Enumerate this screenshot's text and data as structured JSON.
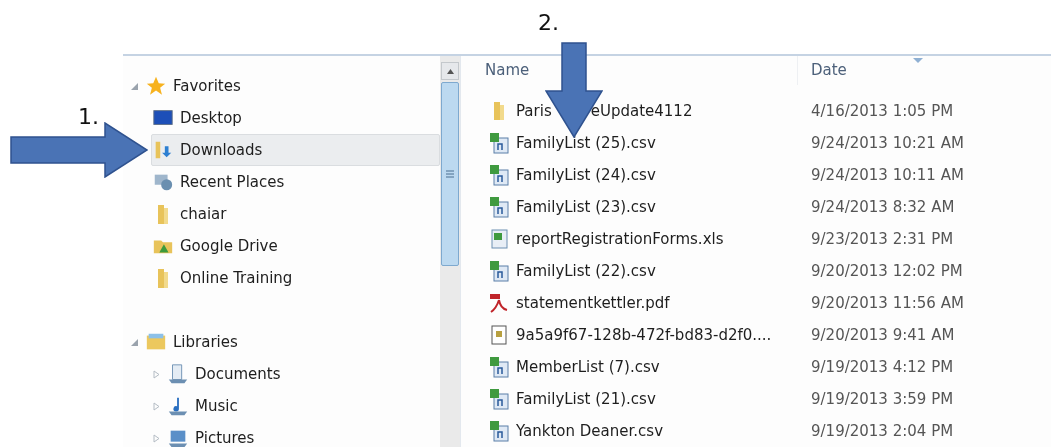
{
  "annotations": [
    {
      "label": "1."
    },
    {
      "label": "2."
    }
  ],
  "navigation": [
    {
      "label": "Favorites",
      "kind": "star",
      "expanded": true,
      "children": [
        {
          "label": "Desktop",
          "kind": "desktop",
          "selected": false
        },
        {
          "label": "Downloads",
          "kind": "downloads",
          "selected": true
        },
        {
          "label": "Recent Places",
          "kind": "recent",
          "selected": false
        },
        {
          "label": "chaiar",
          "kind": "folder",
          "selected": false
        },
        {
          "label": "Google Drive",
          "kind": "drive",
          "selected": false
        },
        {
          "label": "Online Training",
          "kind": "folder",
          "selected": false
        }
      ]
    },
    {
      "label": "Libraries",
      "kind": "libraries",
      "expanded": true,
      "children": [
        {
          "label": "Documents",
          "kind": "documents",
          "expanded": false
        },
        {
          "label": "Music",
          "kind": "music",
          "expanded": false
        },
        {
          "label": "Pictures",
          "kind": "pictures",
          "expanded": false
        }
      ]
    }
  ],
  "columns": [
    {
      "label": "Name",
      "sorted": false
    },
    {
      "label": "Date",
      "sorted": true
    }
  ],
  "files": [
    {
      "name_parts": [
        "Paris",
        "eUpdate4112"
      ],
      "date": "4/16/2013 1:05 PM",
      "kind": "folder"
    },
    {
      "name_parts": [
        "FamilyList (25).csv"
      ],
      "date": "9/24/2013 10:21 AM",
      "kind": "csv"
    },
    {
      "name_parts": [
        "FamilyList (24).csv"
      ],
      "date": "9/24/2013 10:11 AM",
      "kind": "csv"
    },
    {
      "name_parts": [
        "FamilyList (23).csv"
      ],
      "date": "9/24/2013 8:32 AM",
      "kind": "csv"
    },
    {
      "name_parts": [
        "reportRegistrationForms.xls"
      ],
      "date": "9/23/2013 2:31 PM",
      "kind": "xls"
    },
    {
      "name_parts": [
        "FamilyList (22).csv"
      ],
      "date": "9/20/2013 12:02 PM",
      "kind": "csv"
    },
    {
      "name_parts": [
        "statementkettler.pdf"
      ],
      "date": "9/20/2013 11:56 AM",
      "kind": "pdf"
    },
    {
      "name_parts": [
        "9a5a9f67-128b-472f-bd83-d2f0...."
      ],
      "date": "9/20/2013 9:41 AM",
      "kind": "file"
    },
    {
      "name_parts": [
        "MemberList (7).csv"
      ],
      "date": "9/19/2013 4:12 PM",
      "kind": "csv"
    },
    {
      "name_parts": [
        "FamilyList (21).csv"
      ],
      "date": "9/19/2013 3:59 PM",
      "kind": "csv"
    },
    {
      "name_parts": [
        "Yankton Deaner.csv"
      ],
      "date": "9/19/2013 2:04 PM",
      "kind": "csv"
    }
  ]
}
